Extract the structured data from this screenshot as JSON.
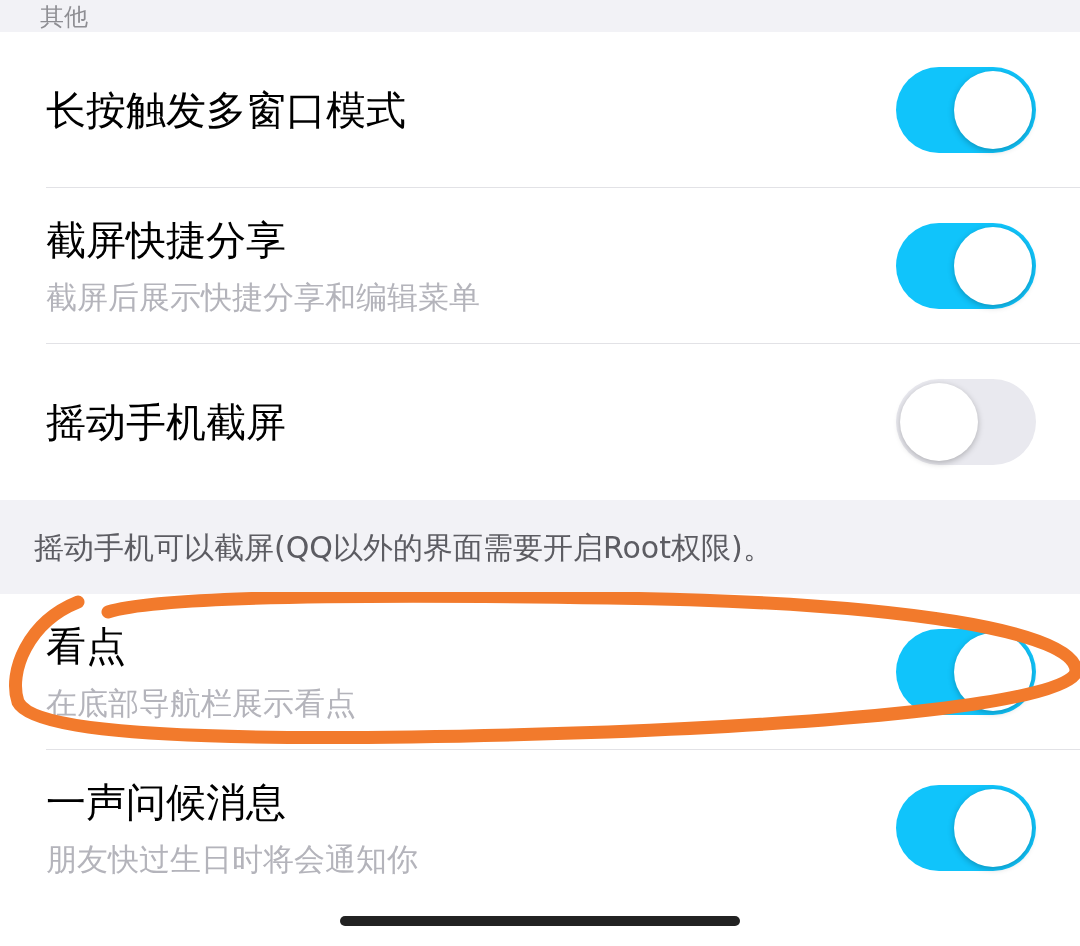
{
  "section_header": "其他",
  "settings": [
    {
      "title": "长按触发多窗口模式",
      "on": true
    },
    {
      "title": "截屏快捷分享",
      "subtitle": "截屏后展示快捷分享和编辑菜单",
      "on": true
    },
    {
      "title": "摇动手机截屏",
      "on": false
    }
  ],
  "footer_note": "摇动手机可以截屏(QQ以外的界面需要开启Root权限)。",
  "settings_2": [
    {
      "title": "看点",
      "subtitle": "在底部导航栏展示看点",
      "on": true
    },
    {
      "title": "一声问候消息",
      "subtitle": "朋友快过生日时将会通知你",
      "on": true
    }
  ]
}
